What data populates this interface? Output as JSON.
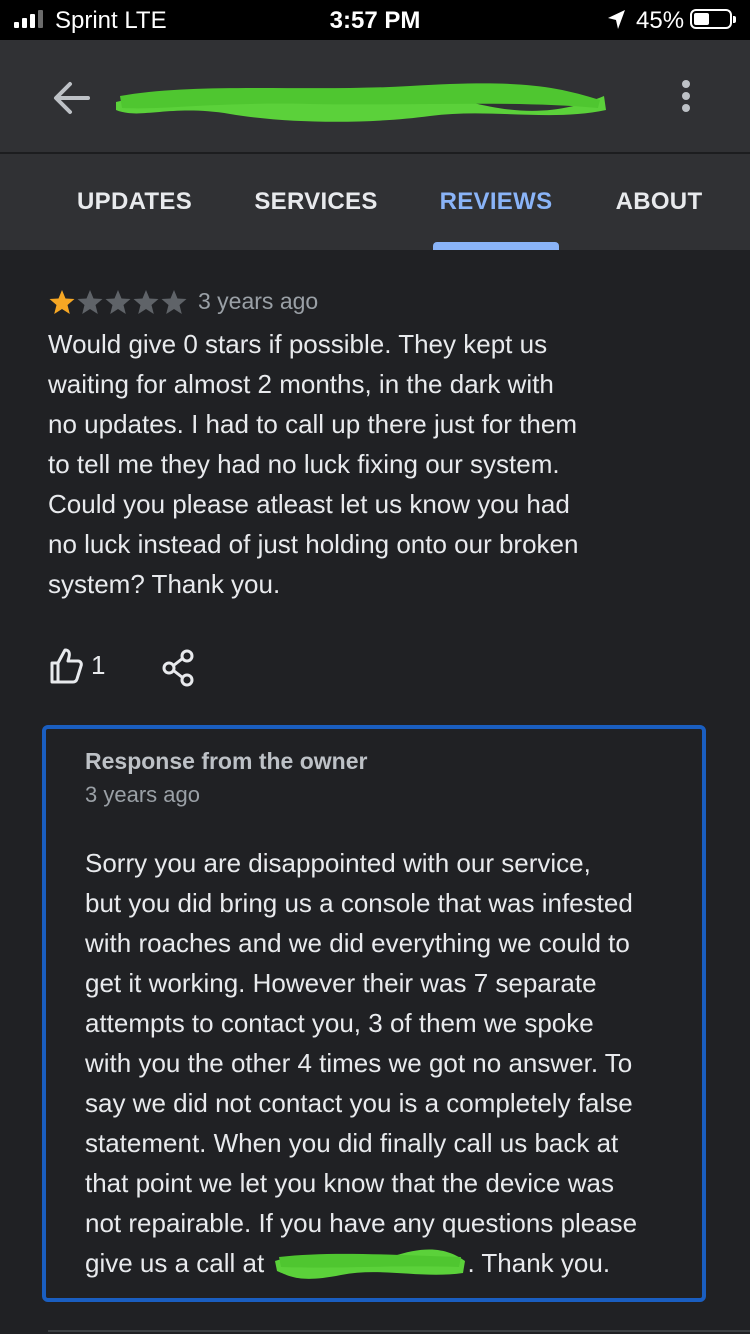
{
  "status_bar": {
    "carrier": "Sprint  LTE",
    "time": "3:57 PM",
    "battery": "45%",
    "battery_level": 0.45
  },
  "app_bar": {
    "title": "",
    "title_redacted": true,
    "redaction_color": "#5bd13a",
    "icons": [
      "back-arrow-icon",
      "more-vert-icon"
    ]
  },
  "tabs": [
    {
      "label": "UPDATES",
      "active": false
    },
    {
      "label": "SERVICES",
      "active": false
    },
    {
      "label": "REVIEWS",
      "active": true
    },
    {
      "label": "ABOUT",
      "active": false
    }
  ],
  "review": {
    "rating": 1,
    "max_rating": 5,
    "time": "3 years ago",
    "text_lines": [
      "Would give 0 stars if possible. They kept us",
      "waiting for almost 2 months, in the dark with",
      "no updates. I had to call up there just for them",
      "to tell me they had no luck fixing our system.",
      "Could you please atleast let us know you had",
      "no luck instead of just holding onto our broken",
      "system? Thank you."
    ],
    "likes": "1"
  },
  "owner_response": {
    "heading": "Response from the owner",
    "time": "3 years ago",
    "text_lines": [
      "Sorry you are disappointed with our service,",
      "but you did bring us a console that was infested",
      "with roaches and we did everything we could to",
      "get it working. However their was 7 separate",
      "attempts to contact you, 3 of them we spoke",
      "with you the other 4 times we got no answer. To",
      "say we did not contact you is a completely false",
      "statement. When you did finally call us back at",
      "that point we let you know that the device was",
      "not repairable. If you have any questions please"
    ],
    "last_line_prefix": "give us a call at ",
    "last_line_suffix": ". Thank you.",
    "highlight_border_color": "#1a5ec0"
  },
  "colors": {
    "background": "#202124",
    "app_bar": "#303134",
    "accent": "#8ab4f8",
    "star_filled": "#f6a724",
    "star_empty": "#5f6368"
  }
}
